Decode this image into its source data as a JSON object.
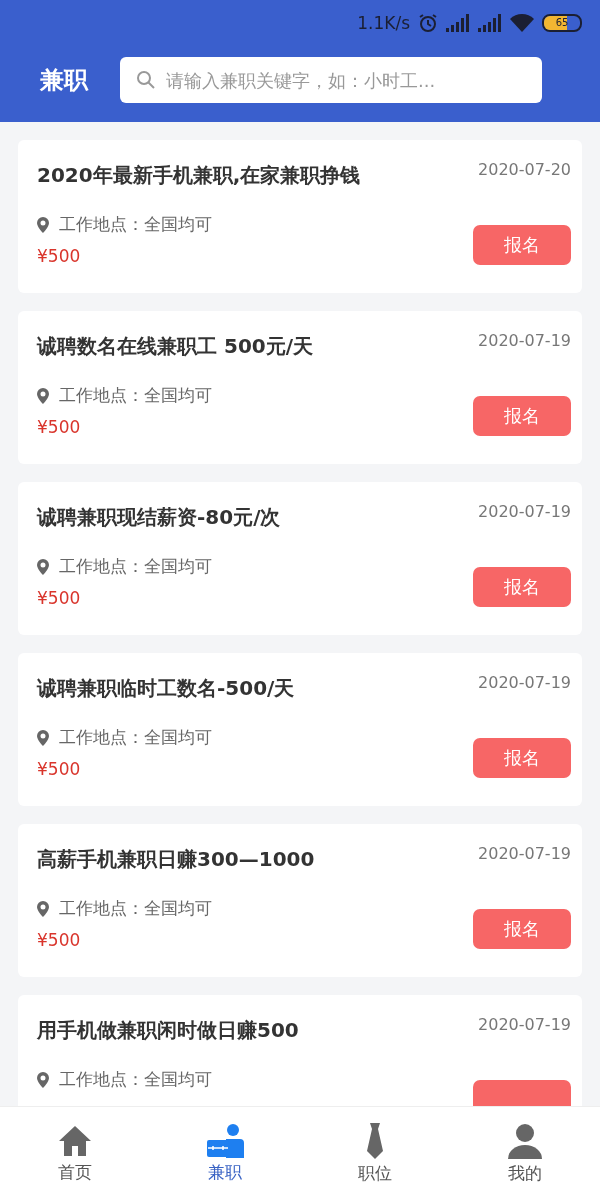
{
  "status_bar": {
    "net_speed": "1.1K/s",
    "battery": "65"
  },
  "header": {
    "title": "兼职",
    "search": {
      "placeholder": "请输入兼职关键字，如：小时工..."
    }
  },
  "jobs": [
    {
      "title": "2020年最新手机兼职,在家兼职挣钱",
      "date": "2020-07-20",
      "location": "工作地点：全国均可",
      "price": "¥500",
      "action": "报名"
    },
    {
      "title": "诚聘数名在线兼职工 500元/天",
      "date": "2020-07-19",
      "location": "工作地点：全国均可",
      "price": "¥500",
      "action": "报名"
    },
    {
      "title": "诚聘兼职现结薪资-80元/次",
      "date": "2020-07-19",
      "location": "工作地点：全国均可",
      "price": "¥500",
      "action": "报名"
    },
    {
      "title": "诚聘兼职临时工数名-500/天",
      "date": "2020-07-19",
      "location": "工作地点：全国均可",
      "price": "¥500",
      "action": "报名"
    },
    {
      "title": "高薪手机兼职日赚300—1000",
      "date": "2020-07-19",
      "location": "工作地点：全国均可",
      "price": "¥500",
      "action": "报名"
    },
    {
      "title": "用手机做兼职闲时做日赚500",
      "date": "2020-07-19",
      "location": "工作地点：全国均可"
    }
  ],
  "tab_bar": [
    {
      "kind": "home",
      "label": "首页",
      "selected": false
    },
    {
      "kind": "parttime",
      "label": "兼职",
      "selected": true
    },
    {
      "kind": "position",
      "label": "职位",
      "selected": false
    },
    {
      "kind": "mine",
      "label": "我的",
      "selected": false
    }
  ]
}
